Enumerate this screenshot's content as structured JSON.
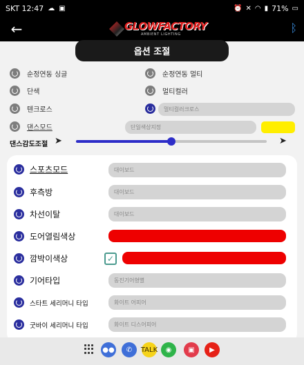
{
  "status_bar": {
    "carrier_time": "SKT 12:47",
    "battery": "71%"
  },
  "app": {
    "logo_text": "GLOWFACTORY",
    "logo_tagline": "AMBIENT LIGHTING"
  },
  "page_title": "옵션 조절",
  "options": [
    {
      "label": "순정연동 싱글",
      "active": false
    },
    {
      "label": "순정연동 멀티",
      "active": false
    },
    {
      "label": "단색",
      "active": false
    },
    {
      "label": "멀티컬러",
      "active": false
    },
    {
      "label": "텐크로스",
      "active": false
    },
    {
      "label": "",
      "active": true,
      "value": "멀티컬러크로스"
    },
    {
      "label": "댄스모드",
      "active": false,
      "value": "단일색상지정"
    }
  ],
  "dance_color": "#ffee00",
  "slider": {
    "label": "댄스감도조절",
    "value": 0.5
  },
  "rows": [
    {
      "label": "스포츠모드",
      "value": "대이보드",
      "underline": true
    },
    {
      "label": "후측방",
      "value": "대이보드"
    },
    {
      "label": "차선이탈",
      "value": "대이보드"
    },
    {
      "label": "도어열림색상",
      "color": "#ee0000"
    },
    {
      "label": "깜박이색상",
      "color": "#ee0000",
      "checked": true
    },
    {
      "label": "기어타입",
      "value": "동진기어형별"
    },
    {
      "label": "스타트 세리머니 타입",
      "value": "화이트 어피어"
    },
    {
      "label": "굿바이 세리머니 타입",
      "value": "화이트 디스어피어"
    }
  ]
}
